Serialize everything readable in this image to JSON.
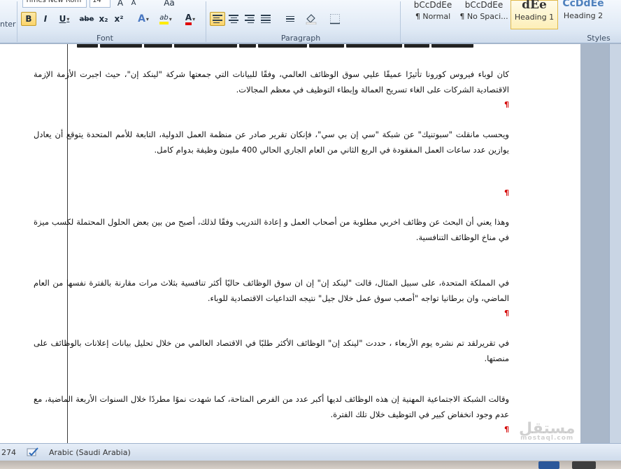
{
  "ribbon": {
    "font_name": "Times New Rom",
    "font_size": "14",
    "clipped_label": "nter",
    "groups": {
      "font": "Font",
      "paragraph": "Paragraph",
      "styles": "Styles"
    },
    "format_buttons": {
      "bold": "B",
      "italic": "I",
      "underline": "U",
      "strike": "abe",
      "subscript": "x₂",
      "superscript": "x²",
      "text_effects": "A",
      "highlight": "ab",
      "font_color": "A",
      "grow": "A",
      "shrink": "A",
      "change_case": "Aa"
    },
    "styles": [
      {
        "preview": "bCcDdEe",
        "name": "¶ Normal"
      },
      {
        "preview": "bCcDdEe",
        "name": "¶ No Spaci..."
      },
      {
        "preview": "dEe",
        "name": "Heading 1"
      },
      {
        "preview": "CcDdEe",
        "name": "Heading 2"
      }
    ]
  },
  "document": {
    "paragraphs": [
      "كان لوباء فيروس كورونا تأثيرًا عميقًا عليي سوق الوظائف العالمي، وفقًا للبيانات التي جمعتها شركة \"لينكد إن\"، حيث اجبرت الأزمة الإزمة الاقتصادية الشركات على الغاء تسريح العمالة وإبطاء التوظيف في معظم المجالات.",
      "ويحسب مانقلت \"سبوتنيك\" عن شبكة \"سي إن بي سي\"، فإنكان تقرير صادر عن منظمة العمل الدولية، التابعة للأمم المتحدة يتوقع أن يعادل يوازين عدد ساعات العمل المفقودة في الربع الثاني من العام الجاري الحالي 400 مليون وظيفة بدوام كامل.",
      "وهذا يعني أن البحث عن وظائف اخربي مطلوبة من أصحاب العمل و إعادة التدريب وفقًا لذلك، أصبح من بين بعض الحلول المحتملة لكسب ميزة في مناخ الوظائف التنافسية.",
      "في المملكة المتحدة، على سبيل المثال، قالت \"لينكد إن\" إن ان سوق الوظائف حاليًا أكثر تنافسية بثلاث مرات مقارنة بالفترة نفسها من العام الماضي، وان برطانيا تواجه \"أصعب سوق عمل خلال جيل\" نتيجه التداعيات الاقتصادية للوباء.",
      "في تقريرلقد تم نشره يوم الأربعاء ، حددت \"لينكد إن\" الوظائف الأكثر طلبًا في الاقتصاد العالمي من خلال تحليل بيانات إعلانات بالوظائف على منصتها.",
      "وقالت الشبكة الاجتماعية المهنية إن هذه الوظائف لديها أكبر عدد من الفرص المتاحة، كما شهدت نموًا مطردًا خلال السنوات الأربعة الماضية، مع عدم وجود انخفاض كبير في التوظيف خلال تلك الفترة."
    ],
    "paragraph_mark": "¶"
  },
  "status_bar": {
    "word_count": "274",
    "language": "Arabic (Saudi Arabia)"
  },
  "watermark": {
    "ar": "مستقل",
    "en": "mostaql.com"
  },
  "colors": {
    "accent": "#fbd46a",
    "page": "#ffffff",
    "error_underline": "#d40000"
  }
}
